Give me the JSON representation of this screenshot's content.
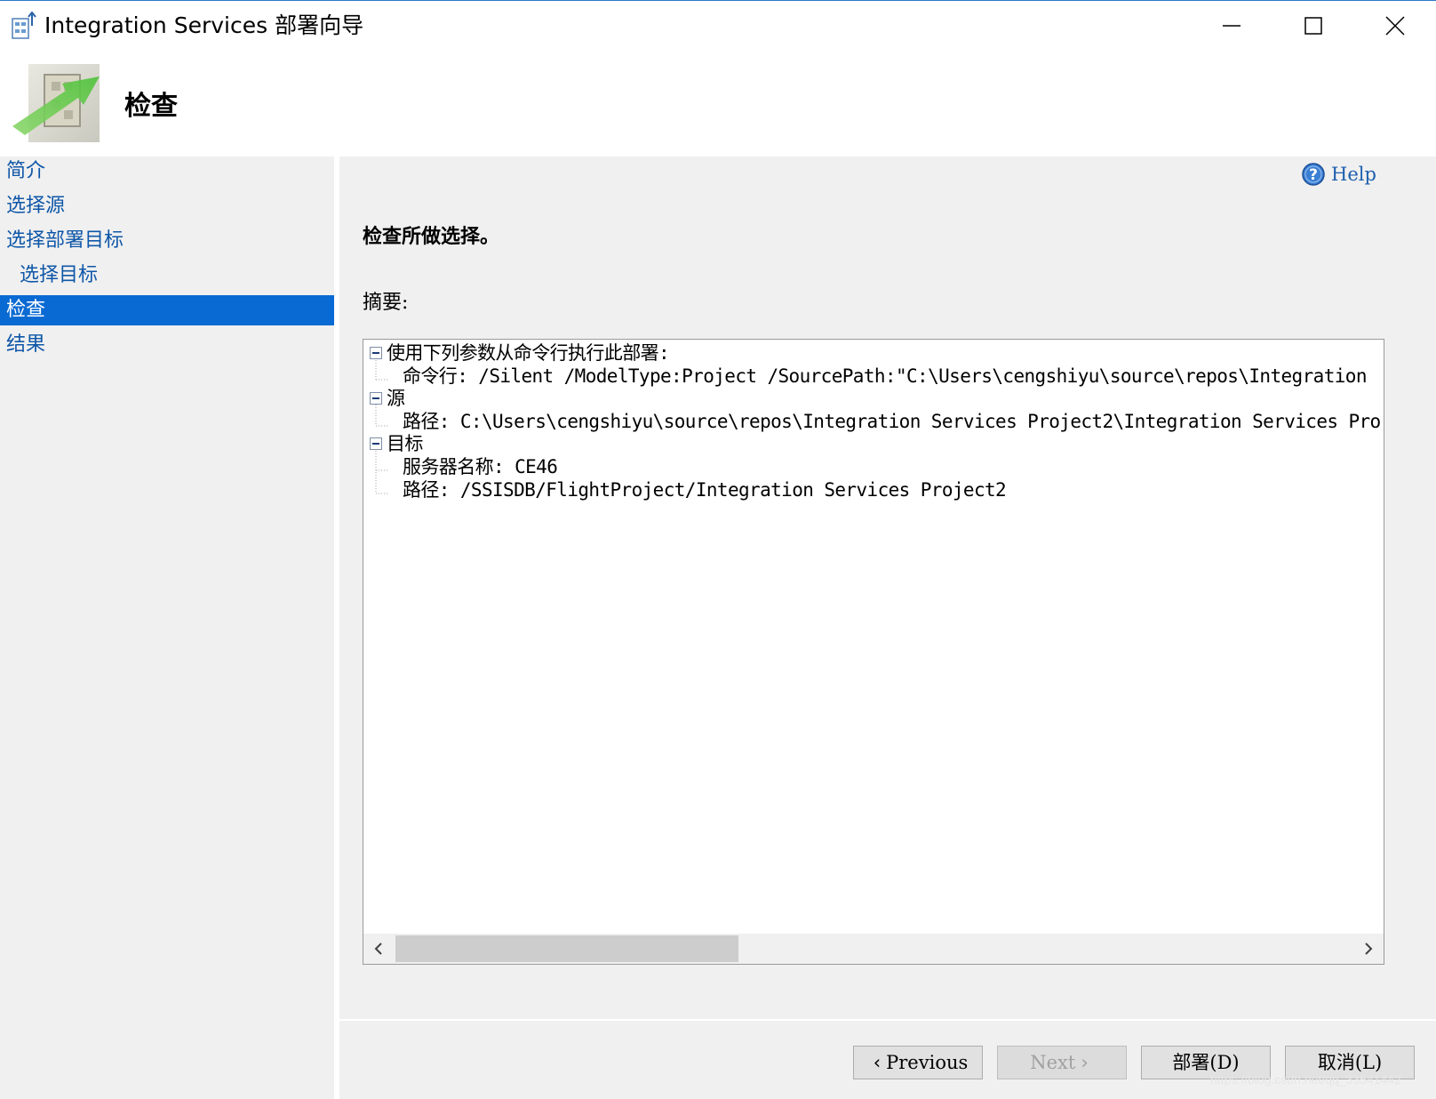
{
  "window": {
    "title": "Integration Services 部署向导",
    "controls": [
      "minimize",
      "maximize",
      "close"
    ]
  },
  "banner": {
    "title": "检查"
  },
  "sidebar": {
    "items": [
      {
        "label": "简介",
        "active": false,
        "indent": false
      },
      {
        "label": "选择源",
        "active": false,
        "indent": false
      },
      {
        "label": "选择部署目标",
        "active": false,
        "indent": false
      },
      {
        "label": "选择目标",
        "active": false,
        "indent": true
      },
      {
        "label": "检查",
        "active": true,
        "indent": false
      },
      {
        "label": "结果",
        "active": false,
        "indent": false
      }
    ]
  },
  "content": {
    "help_label": "Help",
    "heading": "检查所做选择。",
    "summary_label": "摘要:",
    "tree": [
      {
        "label": "使用下列参数从命令行执行此部署:",
        "level": 0,
        "expanded": true
      },
      {
        "label": "命令行: /Silent /ModelType:Project /SourcePath:\"C:\\Users\\cengshiyu\\source\\repos\\Integration",
        "level": 1
      },
      {
        "label": "源",
        "level": 0,
        "expanded": true
      },
      {
        "label": "路径: C:\\Users\\cengshiyu\\source\\repos\\Integration Services Project2\\Integration Services Pro",
        "level": 1
      },
      {
        "label": "目标",
        "level": 0,
        "expanded": true
      },
      {
        "label": "服务器名称: CE46",
        "level": 1
      },
      {
        "label": "路径: /SSISDB/FlightProject/Integration Services Project2",
        "level": 1
      }
    ]
  },
  "buttons": {
    "previous": "Previous",
    "next": "Next",
    "deploy": "部署(D)",
    "cancel": "取消(L)"
  },
  "watermark": "https://blog.csdn.net/qq_33541442",
  "colors": {
    "active_nav_bg": "#0a6ad3",
    "nav_text": "#0f57a8",
    "panel_bg": "#f0f0f0"
  }
}
